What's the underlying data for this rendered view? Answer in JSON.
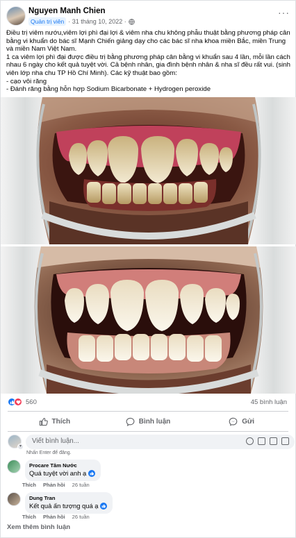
{
  "post": {
    "author": "Nguyen Manh Chien",
    "role": "Quản trị viên",
    "date": "· 31 tháng 10, 2022 ·",
    "more": "···",
    "paragraphs": [
      "Điều trị viêm nướu,viêm lợi phì đại lợi &  viêm nha chu không phẫu thuật bằng phương pháp cân bằng vi khuẩn do bác sĩ Mạnh Chiến giảng dạy cho các bác sĩ nha khoa miền Bắc, miền Trung và miền Nam Việt Nam.",
      "1 ca viêm lợi phì đại được điều trị bằng phương pháp cân bằng vi khuẩn sau 4 lần, mỗi lần  cách nhau 6 ngày cho kết quả tuyệt vời. Cả bệnh nhân, gia đình bệnh nhân & nha sĩ đều rất vui. (sinh viên lớp nha chu TP Hồ Chí Minh). Các kỹ thuật bao gồm:",
      "- cạo vôi răng",
      "- Đánh răng bằng hỗn hợp Sodium Bicarbonate + Hydrogen peroxide"
    ]
  },
  "reactions": {
    "count": "560",
    "comments": "45 bình luận"
  },
  "actions": {
    "like": "Thích",
    "comment": "Bình luận",
    "share": "Gửi"
  },
  "composer": {
    "placeholder": "Viết bình luận...",
    "hint": "Nhấn Enter để đăng."
  },
  "comments": [
    {
      "name": "Procare Tâm Nước",
      "text": "Quá tuyệt vời anh ạ",
      "like": "Thích",
      "reply": "Phản hồi",
      "time": "26 tuần"
    },
    {
      "name": "Dung Tran",
      "text": "Kết quả ấn tượng quá ạ",
      "like": "Thích",
      "reply": "Phản hồi",
      "time": "26 tuần"
    }
  ],
  "see_more": "Xem thêm bình luận",
  "colors": {
    "accent": "#1877f2",
    "love": "#f33e58",
    "muted": "#65676b"
  },
  "icons": [
    "globe-icon",
    "more-icon",
    "like-icon",
    "love-icon",
    "thumb-icon",
    "comment-icon",
    "share-icon",
    "sticker-icon",
    "emoji-icon",
    "camera-icon",
    "gif-icon",
    "verified-icon"
  ]
}
